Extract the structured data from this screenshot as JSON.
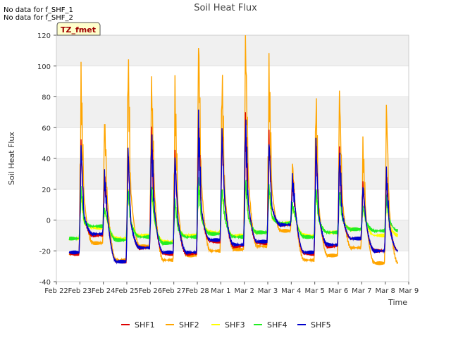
{
  "notes": [
    "No data for f_SHF_1",
    "No data for f_SHF_2"
  ],
  "badge": "TZ_fmet",
  "chart_data": {
    "type": "line",
    "title": "Soil Heat Flux",
    "xlabel": "Time",
    "ylabel": "Soil Heat Flux",
    "ylim": [
      -40,
      120
    ],
    "yticks": [
      -40,
      -20,
      0,
      20,
      40,
      60,
      80,
      100,
      120
    ],
    "xlim": [
      0,
      15
    ],
    "xtick_labels": [
      "Feb 22",
      "Feb 23",
      "Feb 24",
      "Feb 25",
      "Feb 26",
      "Feb 27",
      "Feb 28",
      "Mar 1",
      "Mar 2",
      "Mar 3",
      "Mar 4",
      "Mar 5",
      "Mar 6",
      "Mar 7",
      "Mar 8",
      "Mar 9"
    ],
    "grid": "horizontal bands",
    "legend_position": "bottom",
    "series": [
      {
        "name": "SHF1",
        "color": "#dd0000",
        "peaks": [
          48,
          28,
          45,
          53,
          41,
          60,
          56,
          62,
          52,
          26,
          50,
          43,
          22,
          30
        ],
        "troughs": [
          -22,
          -10,
          -27,
          -18,
          -22,
          -22,
          -14,
          -17,
          -15,
          -3,
          -22,
          -17,
          -12,
          -20
        ]
      },
      {
        "name": "SHF2",
        "color": "#ffa500",
        "peaks": [
          88,
          66,
          102,
          89,
          80,
          116,
          91,
          117,
          92,
          37,
          77,
          84,
          46,
          74
        ],
        "troughs": [
          -22,
          -15,
          -26,
          -17,
          -26,
          -23,
          -20,
          -19,
          -17,
          -7,
          -26,
          -23,
          -18,
          -28
        ]
      },
      {
        "name": "SHF3",
        "color": "#ffff00",
        "peaks": [
          18,
          6,
          20,
          18,
          12,
          22,
          20,
          24,
          20,
          8,
          20,
          18,
          8,
          12
        ],
        "troughs": [
          -12,
          -5,
          -12,
          -10,
          -14,
          -10,
          -8,
          -10,
          -8,
          -2,
          -10,
          -8,
          -6,
          -10
        ]
      },
      {
        "name": "SHF4",
        "color": "#22ee22",
        "peaks": [
          20,
          7,
          20,
          22,
          13,
          24,
          21,
          26,
          22,
          10,
          21,
          18,
          9,
          14
        ],
        "troughs": [
          -12,
          -4,
          -13,
          -11,
          -15,
          -11,
          -9,
          -11,
          -8,
          -2,
          -11,
          -8,
          -6,
          -7
        ]
      },
      {
        "name": "SHF5",
        "color": "#0000cc",
        "peaks": [
          49,
          28,
          46,
          54,
          42,
          61,
          57,
          63,
          52,
          26,
          50,
          43,
          23,
          30
        ],
        "troughs": [
          -21,
          -9,
          -27,
          -18,
          -21,
          -21,
          -13,
          -16,
          -14,
          -3,
          -21,
          -16,
          -12,
          -20
        ]
      }
    ]
  }
}
